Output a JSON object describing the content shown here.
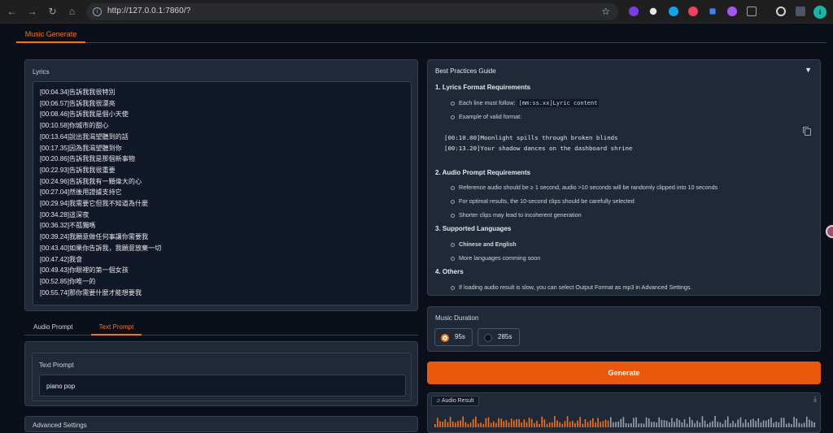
{
  "browser": {
    "url": "http://127.0.0.1:7860/?",
    "profile_initial": "i",
    "nav_icons": [
      "back-icon",
      "forward-icon",
      "reload-icon",
      "home-icon"
    ]
  },
  "main_tab": {
    "label": "Music Generate"
  },
  "lyrics": {
    "label": "Lyrics",
    "lines": [
      "[00:04.34]告訴我我很特別",
      "[00:06.57]告訴我我很漂亮",
      "[00:08.46]告訴我我是個小天使",
      "[00:10.58]你城市的甜心",
      "[00:13.64]說出我渴望聽到的話",
      "[00:17.35]因為我渴望聽到你",
      "[00:20.86]告訴我我是那個新事物",
      "[00:22.93]告訴我我很重要",
      "[00:24.96]告訴我我有一顆偉大的心",
      "[00:27.04]然後用證據支持它",
      "[00:29.94]我需要它但我不知道為什麼",
      "[00:34.28]這深夜",
      "[00:36.32]不孤獨嗎",
      "[00:39.24]我願意做任何事讓你需要我",
      "[00:43.40]如果你告訴我，我願意放棄一切",
      "[00:47.42]我會",
      "[00:49.43]你眼裡的第一個女孩",
      "[00:52.85]你唯一的",
      "[00:55.74]那你需要什麼才能想要我"
    ]
  },
  "prompt_tabs": [
    {
      "label": "Audio Prompt",
      "active": false
    },
    {
      "label": "Text Prompt",
      "active": true
    }
  ],
  "text_prompt": {
    "label": "Text Prompt",
    "value": "piano pop"
  },
  "advanced_settings": {
    "label": "Advanced Settings"
  },
  "guide": {
    "title": "Best Practices Guide",
    "toggle": "▼",
    "sections": [
      {
        "heading": "1. Lyrics Format Requirements",
        "item1_prefix": "Each line must follow: ",
        "item1_code": "[mm:ss.xx]Lyric content",
        "item2": "Example of valid format:",
        "code_lines": [
          "[00:10.00]Moonlight spills through broken blinds",
          "[00:13.20]Your shadow dances on the dashboard shrine"
        ]
      },
      {
        "heading": "2. Audio Prompt Requirements",
        "items": [
          "Reference audio should be ≥ 1 second, audio >10 seconds will be randomly clipped into 10 seconds",
          "For optimal results, the 10-second clips should be carefully selected",
          "Shorter clips may lead to incoherent generation"
        ]
      },
      {
        "heading": "3. Supported Languages",
        "items": [
          "Chinese and English",
          "More languages comming soon"
        ]
      },
      {
        "heading": "4. Others",
        "items": [
          "If loading audio result is slow, you can select Output Format as mp3 in Advanced Settings."
        ]
      }
    ]
  },
  "duration": {
    "label": "Music Duration",
    "options": [
      {
        "label": "95s",
        "selected": true
      },
      {
        "label": "285s",
        "selected": false
      }
    ]
  },
  "generate_button": {
    "label": "Generate"
  },
  "audio_result": {
    "label": "Audio Result",
    "played_fraction": 0.46
  },
  "colors": {
    "accent": "#f97316",
    "button": "#ea580c",
    "panel": "#1f2937",
    "background": "#0b0f19"
  }
}
